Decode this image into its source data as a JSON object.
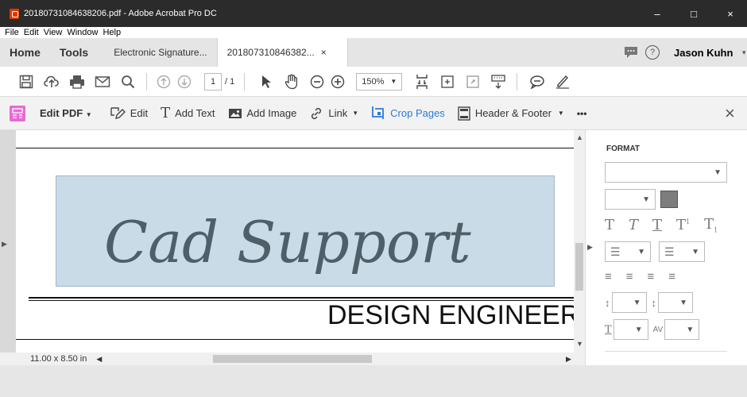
{
  "window": {
    "title": "20180731084638206.pdf - Adobe Acrobat Pro DC",
    "controls": [
      "–",
      "□",
      "×"
    ]
  },
  "menu": [
    "File",
    "Edit",
    "View",
    "Window",
    "Help"
  ],
  "tabs": {
    "home": "Home",
    "tools": "Tools",
    "tab1": "Electronic Signature...",
    "tab2": "201807310846382...",
    "close": "×",
    "user": "Jason Kuhn"
  },
  "toolbar": {
    "page_current": "1",
    "page_total": "/ 1",
    "zoom": "150%"
  },
  "editbar": {
    "edit_pdf": "Edit PDF",
    "edit": "Edit",
    "add_text": "Add Text",
    "add_image": "Add Image",
    "link": "Link",
    "crop_pages": "Crop Pages",
    "header_footer": "Header & Footer",
    "more": "•••",
    "close": "×"
  },
  "document": {
    "signature": "Cad Support",
    "heading": "DESIGN ENGINEER",
    "page_size": "11.00 x 8.50 in"
  },
  "format_panel": {
    "title": "FORMAT",
    "text_styles": [
      "T",
      "T",
      "T",
      "T",
      "T"
    ]
  },
  "colors": {
    "accent": "#2d7bd6",
    "titlebar": "#2b2b2b",
    "editpdf_icon": "#e56bd5",
    "selection": "#c9dbe6"
  }
}
